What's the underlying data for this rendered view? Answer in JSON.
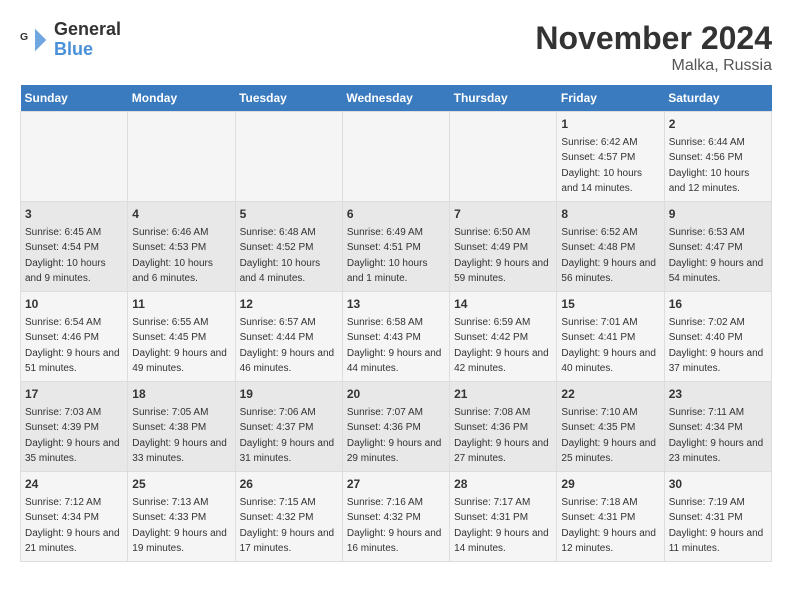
{
  "header": {
    "logo_line1": "General",
    "logo_line2": "Blue",
    "month": "November 2024",
    "location": "Malka, Russia"
  },
  "days_of_week": [
    "Sunday",
    "Monday",
    "Tuesday",
    "Wednesday",
    "Thursday",
    "Friday",
    "Saturday"
  ],
  "weeks": [
    [
      {
        "day": "",
        "info": ""
      },
      {
        "day": "",
        "info": ""
      },
      {
        "day": "",
        "info": ""
      },
      {
        "day": "",
        "info": ""
      },
      {
        "day": "",
        "info": ""
      },
      {
        "day": "1",
        "info": "Sunrise: 6:42 AM\nSunset: 4:57 PM\nDaylight: 10 hours and 14 minutes."
      },
      {
        "day": "2",
        "info": "Sunrise: 6:44 AM\nSunset: 4:56 PM\nDaylight: 10 hours and 12 minutes."
      }
    ],
    [
      {
        "day": "3",
        "info": "Sunrise: 6:45 AM\nSunset: 4:54 PM\nDaylight: 10 hours and 9 minutes."
      },
      {
        "day": "4",
        "info": "Sunrise: 6:46 AM\nSunset: 4:53 PM\nDaylight: 10 hours and 6 minutes."
      },
      {
        "day": "5",
        "info": "Sunrise: 6:48 AM\nSunset: 4:52 PM\nDaylight: 10 hours and 4 minutes."
      },
      {
        "day": "6",
        "info": "Sunrise: 6:49 AM\nSunset: 4:51 PM\nDaylight: 10 hours and 1 minute."
      },
      {
        "day": "7",
        "info": "Sunrise: 6:50 AM\nSunset: 4:49 PM\nDaylight: 9 hours and 59 minutes."
      },
      {
        "day": "8",
        "info": "Sunrise: 6:52 AM\nSunset: 4:48 PM\nDaylight: 9 hours and 56 minutes."
      },
      {
        "day": "9",
        "info": "Sunrise: 6:53 AM\nSunset: 4:47 PM\nDaylight: 9 hours and 54 minutes."
      }
    ],
    [
      {
        "day": "10",
        "info": "Sunrise: 6:54 AM\nSunset: 4:46 PM\nDaylight: 9 hours and 51 minutes."
      },
      {
        "day": "11",
        "info": "Sunrise: 6:55 AM\nSunset: 4:45 PM\nDaylight: 9 hours and 49 minutes."
      },
      {
        "day": "12",
        "info": "Sunrise: 6:57 AM\nSunset: 4:44 PM\nDaylight: 9 hours and 46 minutes."
      },
      {
        "day": "13",
        "info": "Sunrise: 6:58 AM\nSunset: 4:43 PM\nDaylight: 9 hours and 44 minutes."
      },
      {
        "day": "14",
        "info": "Sunrise: 6:59 AM\nSunset: 4:42 PM\nDaylight: 9 hours and 42 minutes."
      },
      {
        "day": "15",
        "info": "Sunrise: 7:01 AM\nSunset: 4:41 PM\nDaylight: 9 hours and 40 minutes."
      },
      {
        "day": "16",
        "info": "Sunrise: 7:02 AM\nSunset: 4:40 PM\nDaylight: 9 hours and 37 minutes."
      }
    ],
    [
      {
        "day": "17",
        "info": "Sunrise: 7:03 AM\nSunset: 4:39 PM\nDaylight: 9 hours and 35 minutes."
      },
      {
        "day": "18",
        "info": "Sunrise: 7:05 AM\nSunset: 4:38 PM\nDaylight: 9 hours and 33 minutes."
      },
      {
        "day": "19",
        "info": "Sunrise: 7:06 AM\nSunset: 4:37 PM\nDaylight: 9 hours and 31 minutes."
      },
      {
        "day": "20",
        "info": "Sunrise: 7:07 AM\nSunset: 4:36 PM\nDaylight: 9 hours and 29 minutes."
      },
      {
        "day": "21",
        "info": "Sunrise: 7:08 AM\nSunset: 4:36 PM\nDaylight: 9 hours and 27 minutes."
      },
      {
        "day": "22",
        "info": "Sunrise: 7:10 AM\nSunset: 4:35 PM\nDaylight: 9 hours and 25 minutes."
      },
      {
        "day": "23",
        "info": "Sunrise: 7:11 AM\nSunset: 4:34 PM\nDaylight: 9 hours and 23 minutes."
      }
    ],
    [
      {
        "day": "24",
        "info": "Sunrise: 7:12 AM\nSunset: 4:34 PM\nDaylight: 9 hours and 21 minutes."
      },
      {
        "day": "25",
        "info": "Sunrise: 7:13 AM\nSunset: 4:33 PM\nDaylight: 9 hours and 19 minutes."
      },
      {
        "day": "26",
        "info": "Sunrise: 7:15 AM\nSunset: 4:32 PM\nDaylight: 9 hours and 17 minutes."
      },
      {
        "day": "27",
        "info": "Sunrise: 7:16 AM\nSunset: 4:32 PM\nDaylight: 9 hours and 16 minutes."
      },
      {
        "day": "28",
        "info": "Sunrise: 7:17 AM\nSunset: 4:31 PM\nDaylight: 9 hours and 14 minutes."
      },
      {
        "day": "29",
        "info": "Sunrise: 7:18 AM\nSunset: 4:31 PM\nDaylight: 9 hours and 12 minutes."
      },
      {
        "day": "30",
        "info": "Sunrise: 7:19 AM\nSunset: 4:31 PM\nDaylight: 9 hours and 11 minutes."
      }
    ]
  ]
}
